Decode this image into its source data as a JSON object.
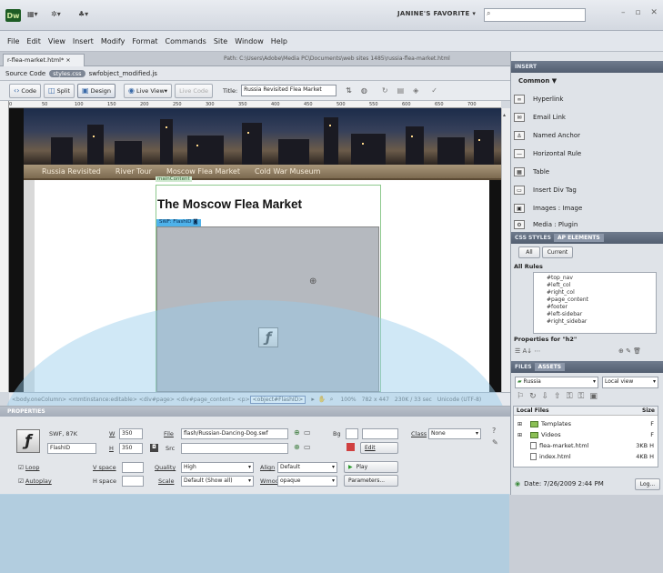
{
  "app": {
    "logo": "Dw",
    "workspace": "JANINE'S FAVORITE",
    "window_controls": "– ▫ ✕",
    "icons": [
      "layout-icon",
      "extend-icon",
      "site-icon"
    ]
  },
  "menu": [
    "File",
    "Edit",
    "View",
    "Insert",
    "Modify",
    "Format",
    "Commands",
    "Site",
    "Window",
    "Help"
  ],
  "doc": {
    "tab": "r-flea-market.html* ×",
    "path": "Path: C:\\Users\\Adobe\\Media PC\\Documents\\web sites 1485\\russia-flea-market.html",
    "related": {
      "source": "Source Code",
      "css": "styles.css",
      "js": "swfobject_modified.js"
    },
    "toolbar": {
      "code": "Code",
      "split": "Split",
      "design": "Design",
      "live_view": "Live View",
      "live_code": "Live Code",
      "title_label": "Title:",
      "title_value": "Russia Revisited Flea Market"
    },
    "ruler_ticks": [
      "0",
      "50",
      "100",
      "150",
      "200",
      "250",
      "300",
      "350",
      "400",
      "450",
      "500",
      "550",
      "600",
      "650",
      "700"
    ]
  },
  "page": {
    "nav": [
      "Russia Revisited",
      "River Tour",
      "Moscow Flea Market",
      "Cold War Museum"
    ],
    "main_label": "mainContent",
    "heading": "The Moscow Flea Market",
    "swf_tag": "SWF: FlashID"
  },
  "tag_selector": {
    "path": "<body.oneColumn> <mmtinstance:editable> <div#page> <div#page_content> <p> ",
    "selected": "<object#FlashID>",
    "zoom": "100%",
    "size": "782 x 447",
    "weight": "230K / 33 sec",
    "encoding": "Unicode (UTF-8)"
  },
  "properties": {
    "header": "PROPERTIES",
    "type": "SWF, 87K",
    "id": "FlashID",
    "w_label": "W",
    "w": "350",
    "h_label": "H",
    "h": "350",
    "file_label": "File",
    "file": "flash/Russian-Dancing-Dog.swf",
    "src_label": "Src",
    "bg_label": "Bg",
    "class_label": "Class",
    "class_value": "None",
    "edit": "Edit",
    "loop": "Loop",
    "autoplay": "Autoplay",
    "vspace": "V space",
    "hspace": "H space",
    "quality_label": "Quality",
    "quality": "High",
    "scale_label": "Scale",
    "scale": "Default (Show all)",
    "align_label": "Align",
    "align": "Default",
    "wmode_label": "Wmode",
    "wmode": "opaque",
    "play": "Play",
    "parameters": "Parameters..."
  },
  "insert": {
    "header": "INSERT",
    "category": "Common",
    "items": [
      "Hyperlink",
      "Email Link",
      "Named Anchor",
      "Horizontal Rule",
      "Table",
      "Insert Div Tag",
      "Images : Image",
      "Media : Plugin"
    ]
  },
  "css": {
    "tab1": "CSS STYLES",
    "tab2": "AP ELEMENTS",
    "all": "All",
    "current": "Current",
    "rules_label": "All Rules",
    "rules": [
      "#top_nav",
      "#left_col",
      "#right_col",
      "#page_content",
      "#footer",
      "#left-sidebar",
      "#right_sidebar"
    ],
    "props_label": "Properties for \"h2\""
  },
  "files": {
    "tab1": "FILES",
    "tab2": "ASSETS",
    "site": "Russia",
    "view": "Local view",
    "col_local": "Local Files",
    "col_size": "Size",
    "rows": [
      {
        "name": "Templates",
        "size": "F"
      },
      {
        "name": "Videos",
        "size": "F"
      },
      {
        "name": "flea-market.html",
        "size": "3KB H"
      },
      {
        "name": "index.html",
        "size": "4KB H"
      }
    ],
    "date": "Date: 7/26/2009 2:44 PM",
    "log": "Log..."
  }
}
